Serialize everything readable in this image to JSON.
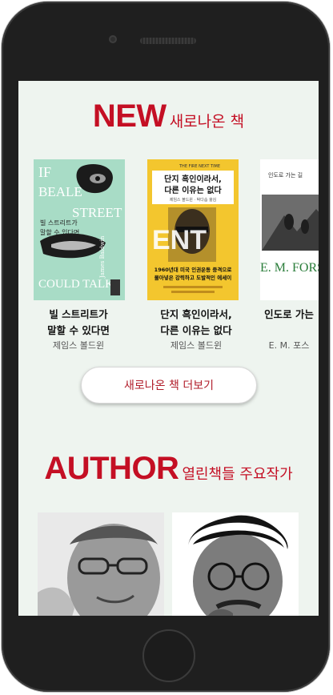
{
  "new_section": {
    "heading_big": "NEW",
    "heading_small": "새로나온 책"
  },
  "books": [
    {
      "title_line1": "빌 스트리트가",
      "title_line2": "말할 수 있다면",
      "author": "제임스 볼드윈",
      "cover_text": [
        "IF",
        "BEALE",
        "STREET",
        "COULD TALK",
        "빌 스트리트가",
        "말할 수 있다면",
        "James Baldwin"
      ]
    },
    {
      "title_line1": "단지 흑인이라서,",
      "title_line2": "다른 이유는 없다",
      "author": "제임스 볼드윈",
      "cover_text": [
        "THE FIRE NEXT TIME",
        "단지 흑인이라서,",
        "다른 이유는 없다",
        "제임스 볼드윈 · 박다솜 옮김",
        "1960년대 미국 인권운동 중격으로",
        "몰아넣은 강력하고 도발적인 에세이"
      ]
    },
    {
      "title_line1": "인도로 가는",
      "title_line2": "",
      "author": "E. M. 포스",
      "cover_text": [
        "인도로 가는 길",
        "E. M. FORS"
      ]
    }
  ],
  "more_button": {
    "label": "새로나온 책 더보기"
  },
  "author_section": {
    "heading_big": "AUTHOR",
    "heading_small": "열린책들 주요작가"
  },
  "authors": [
    {
      "photo": "author-photo-1"
    },
    {
      "photo": "author-photo-2"
    }
  ],
  "colors": {
    "accent": "#c40f24",
    "screen_bg": "#eef4ef",
    "phone_body": "#1f1f1f"
  }
}
